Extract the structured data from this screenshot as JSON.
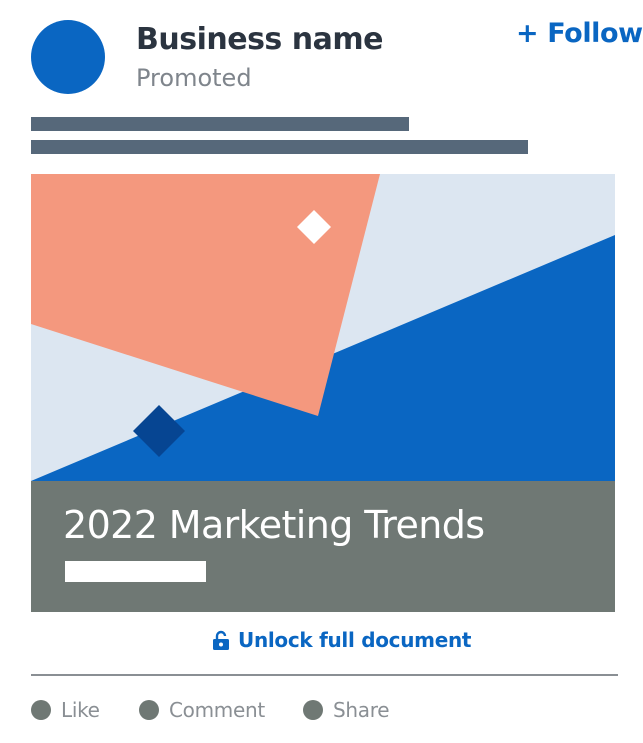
{
  "post": {
    "business_name": "Business name",
    "promoted_label": "Promoted",
    "follow_label": "+ Follow"
  },
  "document": {
    "title": "2022 Marketing Trends",
    "unlock_label": "Unlock full document",
    "unlock_icon": "lock-icon"
  },
  "actions": {
    "like": "Like",
    "comment": "Comment",
    "share": "Share"
  },
  "colors": {
    "brand_blue": "#0a66c2",
    "salmon": "#f4987e",
    "light_blue_gray": "#dce6f1",
    "dark_navy": "#064592",
    "band_gray": "#6f7874",
    "text_line_gray": "#56687a"
  }
}
